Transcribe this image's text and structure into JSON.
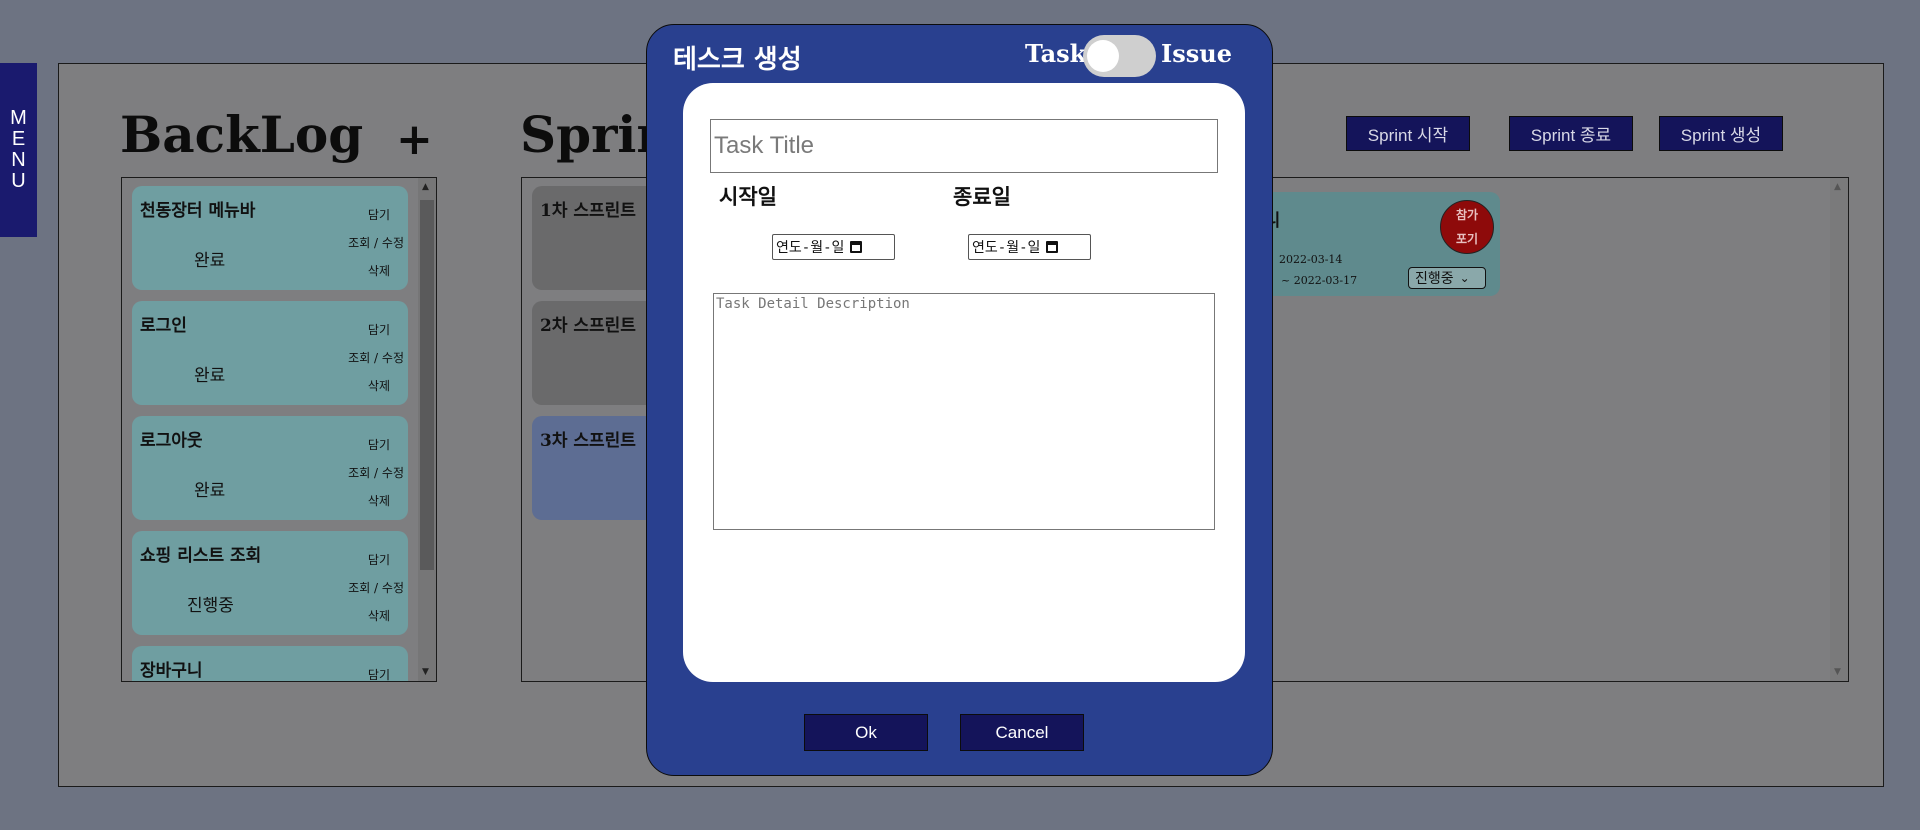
{
  "menu": {
    "letters": [
      "M",
      "E",
      "N",
      "U"
    ]
  },
  "backlog": {
    "heading": "BackLog",
    "add_label": "+",
    "items": [
      {
        "title": "천동장터 메뉴바",
        "status": "완료",
        "act_pull": "담기",
        "act_view": "조회 / 수정",
        "act_delete": "삭제"
      },
      {
        "title": "로그인",
        "status": "완료",
        "act_pull": "담기",
        "act_view": "조회 / 수정",
        "act_delete": "삭제"
      },
      {
        "title": "로그아웃",
        "status": "완료",
        "act_pull": "담기",
        "act_view": "조회 / 수정",
        "act_delete": "삭제"
      },
      {
        "title": "쇼핑 리스트 조회",
        "status": "진행중",
        "act_pull": "담기",
        "act_view": "조회 / 수정",
        "act_delete": "삭제"
      },
      {
        "title": "장바구니",
        "status": "",
        "act_pull": "담기",
        "act_view": "",
        "act_delete": ""
      }
    ]
  },
  "sprint": {
    "heading": "Sprint",
    "cards": [
      {
        "title": "1차 스프린트"
      },
      {
        "title": "2차 스프린트"
      },
      {
        "title": "3차 스프린트"
      }
    ],
    "issue_card": {
      "title": "구니",
      "join_line1": "참가",
      "join_line2": "포기",
      "start": "2022-03-14",
      "end": "~ 2022-03-17",
      "status_select": "진행중"
    },
    "buttons": {
      "start": "Sprint 시작",
      "end": "Sprint 종료",
      "create": "Sprint 생성"
    }
  },
  "modal": {
    "title": "테스크 생성",
    "toggle_left": "Task",
    "toggle_right": "Issue",
    "title_placeholder": "Task Title",
    "start_label": "시작일",
    "end_label": "종료일",
    "date_placeholder": "연도-월-일",
    "desc_placeholder": "Task Detail Description",
    "ok": "Ok",
    "cancel": "Cancel"
  },
  "colors": {
    "modal_bg": "#29408f",
    "button_bg": "#14145a",
    "backlog_card": "#6f9ea1",
    "overlay": "#7e7e80",
    "join_button": "#8e0a0a"
  }
}
